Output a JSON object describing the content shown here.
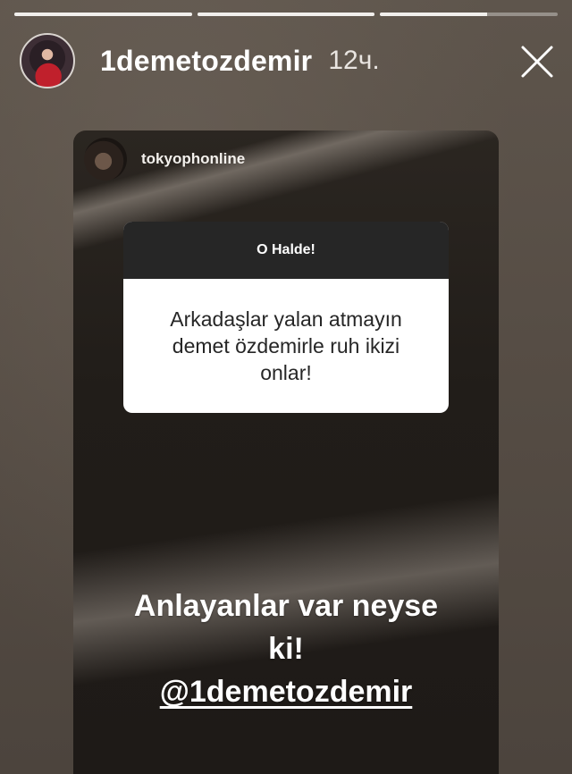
{
  "progress": [
    1,
    1,
    0.6
  ],
  "header": {
    "username": "1demetozdemir",
    "time": "12ч."
  },
  "card": {
    "username": "tokyophonline",
    "question": {
      "title": "O Halde!",
      "answer": "Arkadaşlar yalan atmayın\ndemet özdemirle  ruh ikizi\nonlar!"
    },
    "caption_line1": "Anlayanlar var neyse",
    "caption_line2": "ki!",
    "mention": "@1demetozdemir"
  },
  "icons": {
    "close": "close-icon"
  }
}
